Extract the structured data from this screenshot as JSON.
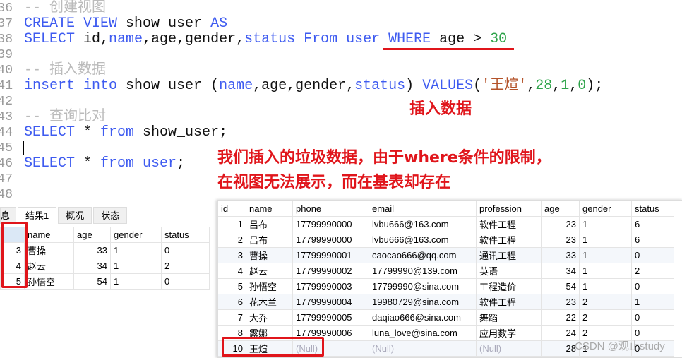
{
  "editor": {
    "lines": [
      {
        "n": "36",
        "parts": [
          {
            "t": "-- 创建视图",
            "c": "cm"
          }
        ]
      },
      {
        "n": "37",
        "parts": [
          {
            "t": "CREATE VIEW ",
            "c": "kw"
          },
          {
            "t": "show_user ",
            "c": "pl"
          },
          {
            "t": "AS",
            "c": "kw"
          }
        ]
      },
      {
        "n": "38",
        "parts": [
          {
            "t": "SELECT ",
            "c": "kw"
          },
          {
            "t": "id,",
            "c": "pl"
          },
          {
            "t": "name",
            "c": "kw"
          },
          {
            "t": ",age,gender,",
            "c": "pl"
          },
          {
            "t": "status From ",
            "c": "kw"
          },
          {
            "t": "user ",
            "c": "kw"
          },
          {
            "t": "WHERE ",
            "c": "kw"
          },
          {
            "t": "age > ",
            "c": "pl"
          },
          {
            "t": "30",
            "c": "num"
          }
        ]
      },
      {
        "n": "39",
        "parts": []
      },
      {
        "n": "40",
        "parts": [
          {
            "t": "-- 插入数据",
            "c": "cm"
          }
        ]
      },
      {
        "n": "41",
        "parts": [
          {
            "t": "insert into ",
            "c": "kw"
          },
          {
            "t": "show_user (",
            "c": "pl"
          },
          {
            "t": "name",
            "c": "kw"
          },
          {
            "t": ",age,gender,",
            "c": "pl"
          },
          {
            "t": "status",
            "c": "kw"
          },
          {
            "t": ") ",
            "c": "pl"
          },
          {
            "t": "VALUES",
            "c": "kw"
          },
          {
            "t": "(",
            "c": "pl"
          },
          {
            "t": "'王煊'",
            "c": "str"
          },
          {
            "t": ",",
            "c": "pl"
          },
          {
            "t": "28",
            "c": "num"
          },
          {
            "t": ",",
            "c": "pl"
          },
          {
            "t": "1",
            "c": "num"
          },
          {
            "t": ",",
            "c": "pl"
          },
          {
            "t": "0",
            "c": "num"
          },
          {
            "t": ");",
            "c": "pl"
          }
        ]
      },
      {
        "n": "42",
        "parts": []
      },
      {
        "n": "43",
        "parts": [
          {
            "t": "-- 查询比对",
            "c": "cm"
          }
        ]
      },
      {
        "n": "44",
        "parts": [
          {
            "t": "SELECT ",
            "c": "kw"
          },
          {
            "t": "* ",
            "c": "pl"
          },
          {
            "t": "from ",
            "c": "kw"
          },
          {
            "t": "show_user;",
            "c": "pl"
          }
        ]
      },
      {
        "n": "45",
        "parts": []
      },
      {
        "n": "46",
        "parts": [
          {
            "t": "SELECT ",
            "c": "kw"
          },
          {
            "t": "* ",
            "c": "pl"
          },
          {
            "t": "from user",
            "c": "kw"
          },
          {
            "t": ";",
            "c": "pl"
          }
        ]
      },
      {
        "n": "47",
        "parts": []
      },
      {
        "n": "48",
        "parts": []
      }
    ]
  },
  "annotations": {
    "insert_note": "插入数据",
    "explain_line1": "我们插入的垃圾数据，由于where条件的限制，",
    "explain_line2": "在视图无法展示，而在基表却存在"
  },
  "view_result": {
    "tabs": [
      "息",
      "结果1",
      "概况",
      "状态"
    ],
    "active_tab": "结果1",
    "columns": [
      "",
      "name",
      "age",
      "gender",
      "status"
    ],
    "rows": [
      [
        "3",
        "曹操",
        "33",
        "1",
        "0"
      ],
      [
        "4",
        "赵云",
        "34",
        "1",
        "2"
      ],
      [
        "5",
        "孙悟空",
        "54",
        "1",
        "0"
      ]
    ]
  },
  "base_table": {
    "columns": [
      "id",
      "name",
      "phone",
      "email",
      "profession",
      "age",
      "gender",
      "status"
    ],
    "rows": [
      [
        "1",
        "吕布",
        "17799990000",
        "lvbu666@163.com",
        "软件工程",
        "23",
        "1",
        "6"
      ],
      [
        "2",
        "吕布",
        "17799990000",
        "lvbu666@163.com",
        "软件工程",
        "23",
        "1",
        "6"
      ],
      [
        "3",
        "曹操",
        "17799990001",
        "caocao666@qq.com",
        "通讯工程",
        "33",
        "1",
        "0"
      ],
      [
        "4",
        "赵云",
        "17799990002",
        "17799990@139.com",
        "英语",
        "34",
        "1",
        "2"
      ],
      [
        "5",
        "孙悟空",
        "17799990003",
        "17799990@sina.com",
        "工程造价",
        "54",
        "1",
        "0"
      ],
      [
        "6",
        "花木兰",
        "17799990004",
        "19980729@sina.com",
        "软件工程",
        "23",
        "2",
        "1"
      ],
      [
        "7",
        "大乔",
        "17799990005",
        "daqiao666@sina.com",
        "舞蹈",
        "22",
        "2",
        "0"
      ],
      [
        "8",
        "露娜",
        "17799990006",
        "luna_love@sina.com",
        "应用数学",
        "24",
        "2",
        "0"
      ],
      [
        "10",
        "王煊",
        "(Null)",
        "(Null)",
        "(Null)",
        "28",
        "1",
        "0"
      ]
    ]
  },
  "watermark": "CSDN @观止study"
}
